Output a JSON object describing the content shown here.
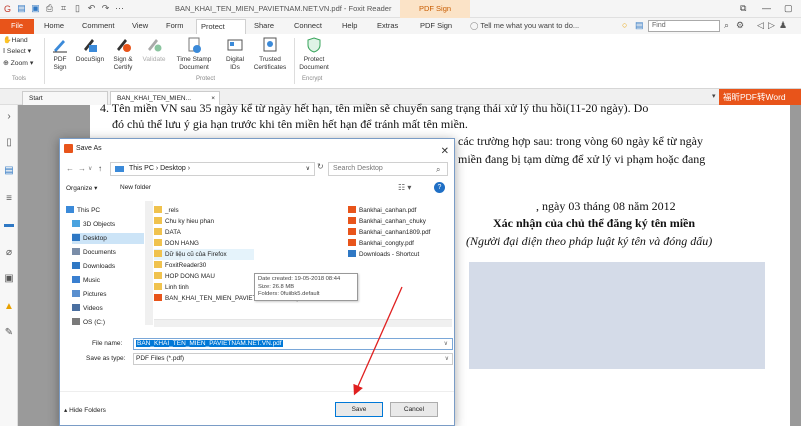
{
  "titlebar": {
    "title": "BAN_KHAI_TEN_MIEN_PAVIETNAM.NET.VN.pdf - Foxit Reader",
    "pdf_sign_tab": "PDF Sign",
    "window_controls": [
      "⧉",
      "—",
      "▢"
    ]
  },
  "tabs": [
    "File",
    "Home",
    "Comment",
    "View",
    "Form",
    "Protect",
    "Share",
    "Connect",
    "Help",
    "Extras",
    "PDF Sign"
  ],
  "active_tab": "Protect",
  "tell_me": "Tell me what you want to do...",
  "find_placeholder": "Find",
  "ribbon": {
    "tools": {
      "hand": "Hand",
      "select": "Select",
      "zoom": "Zoom",
      "label": "Tools"
    },
    "protect_buttons": [
      {
        "label": "PDF\nSign",
        "icon": "pen-sign-icon"
      },
      {
        "label": "DocuSign",
        "icon": "docusign-icon"
      },
      {
        "label": "Sign &\nCertify",
        "icon": "certify-icon"
      },
      {
        "label": "Validate",
        "icon": "validate-icon"
      },
      {
        "label": "Time Stamp\nDocument",
        "icon": "timestamp-icon"
      },
      {
        "label": "Digital\nIDs",
        "icon": "digital-id-icon"
      },
      {
        "label": "Trusted\nCertificates",
        "icon": "certificate-icon"
      },
      {
        "label": "Protect\nDocument",
        "icon": "shield-icon"
      }
    ],
    "protect_label": "Protect",
    "encrypt_label": "Encrypt"
  },
  "doctabs": {
    "start": "Start",
    "file": "BAN_KHAI_TEN_MIEN...",
    "promo": "福昕PDF转Word"
  },
  "document": {
    "line1": "4. Tên miền VN sau 35 ngày kể từ ngày hết hạn, tên miền sẽ chuyển sang trạng thái xử lý thu hồi(11-20 ngày). Do",
    "line2": "đó chủ thể lưu ý gia hạn trước khi tên miền hết hạn để tránh mất tên miền.",
    "line3": "các trường hợp sau: trong vòng 60 ngày kể từ ngày",
    "line4": "miền đang bị tạm dừng để xử lý vi phạm hoặc đang",
    "date": ", ngày 03 tháng 08 năm 2012",
    "confirm": "Xác nhận của chủ thể đăng ký tên miền",
    "note": "(Người đại diện theo pháp luật ký tên và đóng dấu)"
  },
  "dialog": {
    "title": "Save As",
    "breadcrumb": "This PC  ›  Desktop  ›",
    "search_placeholder": "Search Desktop",
    "organize": "Organize ▾",
    "new_folder": "New folder",
    "nav_items": [
      {
        "label": "This PC",
        "color": "#3b8ad9"
      },
      {
        "label": "3D Objects",
        "color": "#4aa3df"
      },
      {
        "label": "Desktop",
        "color": "#2f78c4"
      },
      {
        "label": "Documents",
        "color": "#7a8da8"
      },
      {
        "label": "Downloads",
        "color": "#2f78c4"
      },
      {
        "label": "Music",
        "color": "#3a7fd0"
      },
      {
        "label": "Pictures",
        "color": "#5a8fcf"
      },
      {
        "label": "Videos",
        "color": "#4a6fa0"
      },
      {
        "label": "OS (C:)",
        "color": "#7a7a7a"
      }
    ],
    "files_col1": [
      {
        "label": "_rels",
        "type": "folder"
      },
      {
        "label": "Chu ky hieu phan",
        "type": "folder"
      },
      {
        "label": "DATA",
        "type": "folder"
      },
      {
        "label": "DON HANG",
        "type": "folder"
      },
      {
        "label": "Dữ liệu cũ của Firefox",
        "type": "folder"
      },
      {
        "label": "FoxitReader30",
        "type": "folder"
      },
      {
        "label": "HOP DONG MAU",
        "type": "folder"
      },
      {
        "label": "Linh tinh",
        "type": "folder"
      },
      {
        "label": "BAN_KHAI_TEN_MIEN_PAVIETNAM.NET.VN.pdf",
        "type": "pdf"
      }
    ],
    "files_col2": [
      {
        "label": "Bankhai_canhan.pdf",
        "type": "pdf"
      },
      {
        "label": "Bankhai_canhan_chuky",
        "type": "pdf"
      },
      {
        "label": "Bankhai_canhan1809.pdf",
        "type": "pdf"
      },
      {
        "label": "Bankhai_congty.pdf",
        "type": "pdf"
      },
      {
        "label": "Downloads - Shortcut",
        "type": "shortcut"
      }
    ],
    "tooltip": {
      "created": "Date created: 19-05-2018 08:44",
      "size": "Size: 26.8 MB",
      "folders": "Folders: 0fuiibk5.default"
    },
    "file_name_label": "File name:",
    "file_name": "BAN_KHAI_TEN_MIEN_PAVIETNAM.NET.VN.pdf",
    "save_type_label": "Save as type:",
    "save_type": "PDF Files (*.pdf)",
    "hide_folders": "Hide Folders",
    "save": "Save",
    "cancel": "Cancel"
  },
  "colors": {
    "accent": "#e8541a",
    "selection": "#0078d7",
    "arrow": "#e02020"
  }
}
